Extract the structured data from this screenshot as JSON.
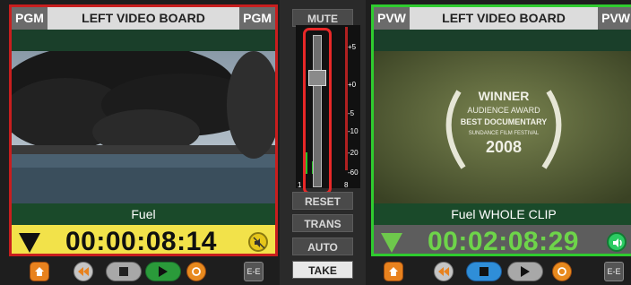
{
  "left_board": {
    "tag_left": "PGM",
    "title": "LEFT VIDEO BOARD",
    "tag_right": "PGM",
    "clip_name": "Fuel",
    "timecode": "00:00:08:14",
    "status_color": "#c81e1e"
  },
  "right_board": {
    "tag_left": "PVW",
    "title": "LEFT VIDEO BOARD",
    "tag_right": "PVW",
    "clip_name": "Fuel WHOLE CLIP",
    "timecode": "00:02:08:29",
    "status_color": "#2fcc2f",
    "poster": {
      "line1": "WINNER",
      "line2": "AUDIENCE AWARD",
      "line3": "BEST DOCUMENTARY",
      "line4": "SUNDANCE FILM FESTIVAL",
      "year": "2008"
    }
  },
  "audio": {
    "mute_label": "MUTE",
    "reset_label": "RESET",
    "trans_label": "TRANS",
    "auto_label": "AUTO",
    "take_label": "TAKE",
    "scale": [
      "+5",
      "+0",
      "-5",
      "-10",
      "-20",
      "-60"
    ],
    "meter_left_label": "1",
    "meter_right_label": "8"
  },
  "controls": {
    "ee_label": "E-E",
    "icons": [
      "home-icon",
      "rewind-icon",
      "stop-icon",
      "play-icon",
      "loop-icon"
    ]
  }
}
